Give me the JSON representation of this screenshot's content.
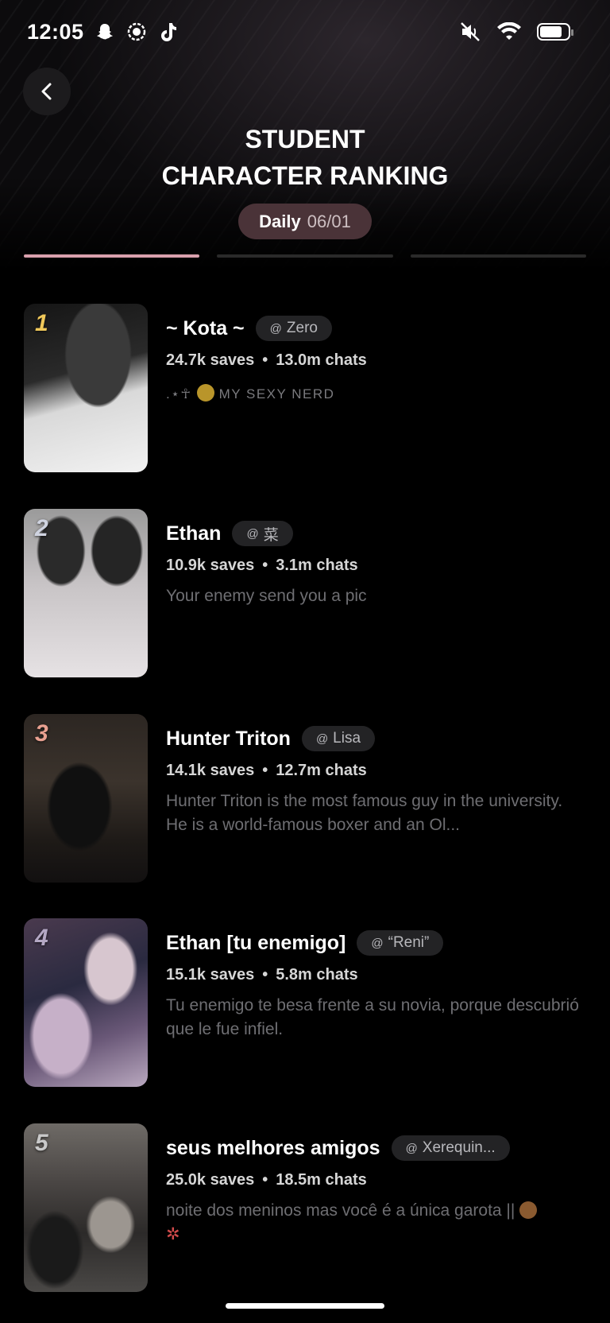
{
  "status_bar": {
    "time": "12:05"
  },
  "header": {
    "title_line1": "STUDENT",
    "title_line2": "CHARACTER RANKING",
    "period_label": "Daily",
    "period_date": "06/01"
  },
  "characters": [
    {
      "rank": "1",
      "name": "~ Kota ~",
      "creator": "Zero",
      "saves": "24.7k saves",
      "chats": "13.0m chats",
      "description": ".⋆☥ 🤓 MY SEXY NERD",
      "desc_prefix": ".⋆☥",
      "desc_text": "MY SEXY NERD"
    },
    {
      "rank": "2",
      "name": "Ethan",
      "creator": "菜",
      "saves": "10.9k saves",
      "chats": "3.1m chats",
      "description": "Your enemy send you a pic"
    },
    {
      "rank": "3",
      "name": "Hunter Triton",
      "creator": "Lisa",
      "saves": "14.1k saves",
      "chats": "12.7m chats",
      "description": "Hunter Triton is the most famous guy in the university. He is a world-famous boxer and an Ol..."
    },
    {
      "rank": "4",
      "name": "Ethan [tu enemigo]",
      "creator": "“Reni”",
      "saves": "15.1k saves",
      "chats": "5.8m chats",
      "description": "Tu enemigo te besa frente a su novia, porque descubrió que le fue infiel."
    },
    {
      "rank": "5",
      "name": "seus melhores amigos",
      "creator": "Xerequin...",
      "saves": "25.0k saves",
      "chats": "18.5m chats",
      "description": "noite dos meninos mas você é a única garota ||🙈💢",
      "desc_text": "noite dos meninos mas você é a única garota ||"
    }
  ],
  "colors": {
    "accent": "#d9a0ad",
    "chip_bg": "#4a3338",
    "background": "#000000"
  }
}
